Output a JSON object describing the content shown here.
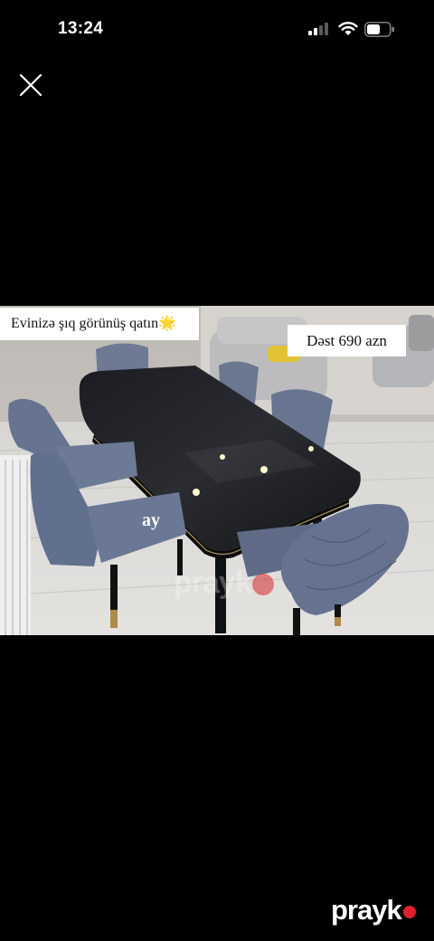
{
  "status_bar": {
    "time": "13:24",
    "signal_icon": "cellular-signal-icon",
    "wifi_icon": "wifi-icon",
    "battery_icon": "battery-icon"
  },
  "viewer": {
    "close_icon": "close-icon"
  },
  "photo": {
    "caption": "Evinizə şıq görünüş qatın🌟",
    "price": "Dəst 690 azn",
    "mark": "ay",
    "watermark": "prayk"
  },
  "branding": {
    "name": "prayk",
    "accent": "#e0202f"
  }
}
